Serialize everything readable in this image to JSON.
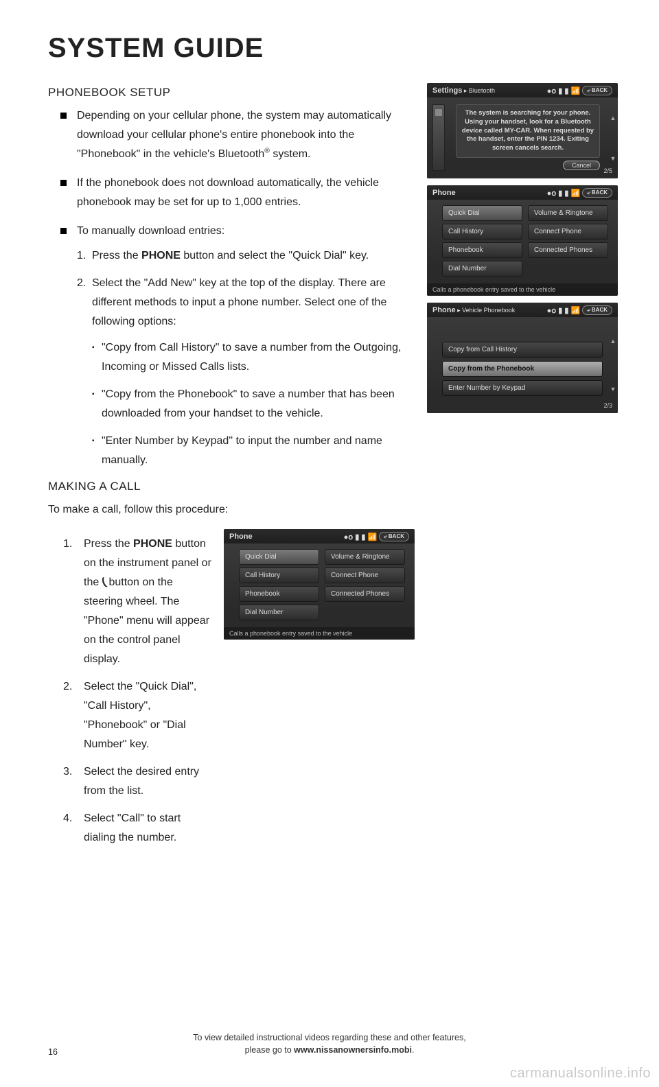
{
  "page": {
    "title": "SYSTEM GUIDE",
    "number": "16",
    "watermark": "carmanualsonline.info"
  },
  "footer": {
    "line1": "To view detailed instructional videos regarding these and other features,",
    "line2_pre": "please go to ",
    "line2_bold": "www.nissanownersinfo.mobi",
    "line2_post": "."
  },
  "phonebook": {
    "heading": "PHONEBOOK SETUP",
    "b1_pre": "Depending on your cellular phone, the system may automatically download your cellular phone's entire phonebook into the \"Phonebook\" in the vehicle's Bluetooth",
    "b1_sup": "®",
    "b1_post": " system.",
    "b2": "If the phonebook does not download automatically, the vehicle phonebook may be set for up to 1,000 entries.",
    "b3": "To manually download entries:",
    "n1_pre": "Press the ",
    "n1_bold": "PHONE",
    "n1_post": " button and select the \"Quick Dial\" key.",
    "n2": "Select the \"Add New\" key at the top of the display. There are different methods to input a phone number. Select one of the following options:",
    "s1": "\"Copy from Call History\" to save a number from the Outgoing, Incoming or Missed Calls lists.",
    "s2": "\"Copy from the Phonebook\" to save a number that has been downloaded from your handset to the vehicle.",
    "s3": "\"Enter Number by Keypad\" to input the number and name manually."
  },
  "call": {
    "heading": "MAKING A CALL",
    "intro": "To make a call, follow this procedure:",
    "n1_pre": "Press the ",
    "n1_bold": "PHONE",
    "n1_mid": " button on the instrument panel or the ",
    "n1_glyph": "(",
    "n1_post": " button on the steering wheel. The \"Phone\" menu will appear on the control panel display.",
    "n2": "Select the \"Quick Dial\", \"Call History\", \"Phonebook\" or \"Dial Number\" key.",
    "n3": "Select the desired entry from the list.",
    "n4": "Select \"Call\" to start dialing the number."
  },
  "shots": {
    "back": "BACK",
    "s1": {
      "title": "Settings",
      "crumb": " ▸ Bluetooth",
      "dialog": "The system is searching for your phone. Using your handset, look for a Bluetooth device called MY-CAR. When requested by the handset, enter the PIN 1234. Exiting screen cancels search.",
      "cancel": "Cancel",
      "page": "2/5"
    },
    "s2": {
      "title": "Phone",
      "left": [
        "Quick Dial",
        "Call History",
        "Phonebook",
        "Dial Number"
      ],
      "right": [
        "Volume & Ringtone",
        "Connect Phone",
        "Connected Phones"
      ],
      "foot": "Calls a phonebook entry saved to the vehicle"
    },
    "s3": {
      "title": "Phone",
      "crumb": " ▸ Vehicle Phonebook",
      "items": [
        "Copy from Call History",
        "Copy from the Phonebook",
        "Enter Number by Keypad"
      ],
      "page": "2/3"
    },
    "s4": {
      "title": "Phone",
      "left": [
        "Quick Dial",
        "Call History",
        "Phonebook",
        "Dial Number"
      ],
      "right": [
        "Volume & Ringtone",
        "Connect Phone",
        "Connected Phones"
      ],
      "foot": "Calls a phonebook entry saved to the vehicle"
    }
  }
}
